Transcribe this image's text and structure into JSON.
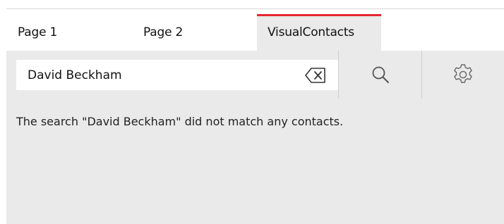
{
  "tabs": [
    {
      "label": "Page 1"
    },
    {
      "label": "Page 2"
    },
    {
      "label": "VisualContacts",
      "active": true
    }
  ],
  "search": {
    "value": "David Beckham",
    "clear_icon": "backspace-clear-icon",
    "search_icon": "magnifier-icon",
    "settings_icon": "gear-icon"
  },
  "message": "The search \"David Beckham\" did not match any contacts.",
  "colors": {
    "accent": "#e8262f",
    "panel_bg": "#eaeaea"
  }
}
